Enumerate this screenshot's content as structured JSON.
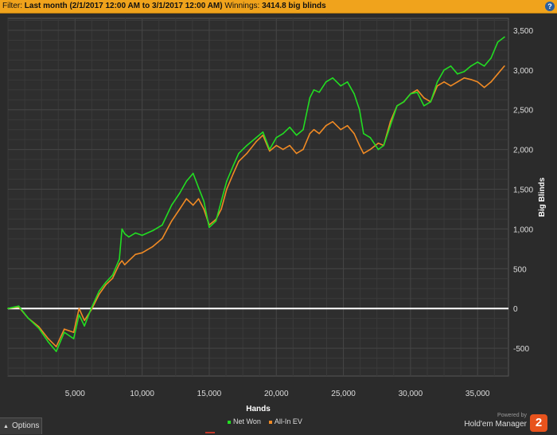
{
  "filter": {
    "label": "Filter:",
    "value": "Last month (2/1/2017 12:00 AM to 3/1/2017 12:00 AM)",
    "winnings_label": "Winnings:",
    "winnings_value": "3414.8 big blinds",
    "help_icon": "?"
  },
  "bottom": {
    "options_label": "Options",
    "powered_by": "Powered by",
    "brand": "Hold'em Manager",
    "brand_badge": "2"
  },
  "colors": {
    "net_won": "#22dd22",
    "all_in_ev": "#f08a24",
    "zero_line": "#ffffff",
    "plot_bg": "#2e2e2e",
    "grid": "#444444"
  },
  "chart_data": {
    "type": "line",
    "xlabel": "Hands",
    "ylabel": "Big Blinds",
    "xlim": [
      0,
      37300
    ],
    "ylim": [
      -850,
      3650
    ],
    "xticks": [
      5000,
      10000,
      15000,
      20000,
      25000,
      30000,
      35000
    ],
    "xtick_labels": [
      "5,000",
      "10,000",
      "15,000",
      "20,000",
      "25,000",
      "30,000",
      "35,000"
    ],
    "yticks": [
      -500,
      0,
      500,
      1000,
      1500,
      2000,
      2500,
      3000,
      3500
    ],
    "ytick_labels": [
      "-500",
      "0",
      "500",
      "1,000",
      "1,500",
      "2,000",
      "2,500",
      "3,000",
      "3,500"
    ],
    "y_axis_side": "right",
    "grid": true,
    "legend_position": "bottom-center",
    "series": [
      {
        "name": "Net Won",
        "x": [
          0,
          800,
          1500,
          2300,
          3000,
          3600,
          4200,
          4900,
          5300,
          5700,
          6200,
          6800,
          7300,
          7800,
          8300,
          8500,
          8700,
          9000,
          9500,
          10000,
          10800,
          11500,
          12200,
          12800,
          13300,
          13800,
          14200,
          14600,
          15000,
          15500,
          15900,
          16300,
          16800,
          17200,
          17800,
          18500,
          19000,
          19500,
          20000,
          20500,
          21000,
          21500,
          22000,
          22500,
          22800,
          23200,
          23700,
          24200,
          24800,
          25300,
          25800,
          26200,
          26500,
          27000,
          27600,
          28000,
          28500,
          29000,
          29500,
          30000,
          30500,
          31000,
          31500,
          32000,
          32500,
          33000,
          33500,
          34000,
          34500,
          35000,
          35500,
          36000,
          36500,
          37000
        ],
        "y": [
          0,
          30,
          -120,
          -250,
          -420,
          -540,
          -300,
          -380,
          -80,
          -220,
          0,
          220,
          330,
          420,
          620,
          1000,
          940,
          900,
          950,
          920,
          980,
          1050,
          1300,
          1450,
          1600,
          1700,
          1520,
          1350,
          1020,
          1100,
          1350,
          1600,
          1800,
          1950,
          2050,
          2150,
          2220,
          2000,
          2150,
          2200,
          2280,
          2180,
          2250,
          2650,
          2750,
          2720,
          2850,
          2900,
          2800,
          2850,
          2700,
          2500,
          2200,
          2150,
          2000,
          2050,
          2300,
          2550,
          2600,
          2700,
          2720,
          2550,
          2600,
          2850,
          3000,
          3050,
          2950,
          2980,
          3050,
          3100,
          3050,
          3150,
          3350,
          3414.8
        ]
      },
      {
        "name": "All-In EV",
        "x": [
          0,
          800,
          1500,
          2300,
          3000,
          3600,
          4200,
          4900,
          5300,
          5700,
          6200,
          6800,
          7300,
          7800,
          8300,
          8500,
          8700,
          9000,
          9500,
          10000,
          10800,
          11500,
          12200,
          12800,
          13300,
          13800,
          14200,
          14600,
          15000,
          15500,
          15900,
          16300,
          16800,
          17200,
          17800,
          18500,
          19000,
          19500,
          20000,
          20500,
          21000,
          21500,
          22000,
          22500,
          22800,
          23200,
          23700,
          24200,
          24800,
          25300,
          25800,
          26200,
          26500,
          27000,
          27600,
          28000,
          28500,
          29000,
          29500,
          30000,
          30500,
          31000,
          31500,
          32000,
          32500,
          33000,
          33500,
          34000,
          34500,
          35000,
          35500,
          36000,
          36500,
          37000
        ],
        "y": [
          0,
          20,
          -120,
          -230,
          -380,
          -480,
          -260,
          -300,
          0,
          -150,
          -20,
          180,
          300,
          380,
          560,
          600,
          550,
          600,
          680,
          700,
          780,
          880,
          1100,
          1250,
          1380,
          1300,
          1380,
          1250,
          1050,
          1120,
          1250,
          1500,
          1700,
          1850,
          1950,
          2100,
          2180,
          1980,
          2050,
          2000,
          2050,
          1950,
          2000,
          2200,
          2250,
          2200,
          2300,
          2350,
          2250,
          2300,
          2200,
          2050,
          1950,
          2000,
          2080,
          2050,
          2350,
          2550,
          2600,
          2700,
          2750,
          2650,
          2600,
          2800,
          2850,
          2800,
          2850,
          2900,
          2880,
          2850,
          2780,
          2850,
          2950,
          3050
        ]
      }
    ]
  }
}
